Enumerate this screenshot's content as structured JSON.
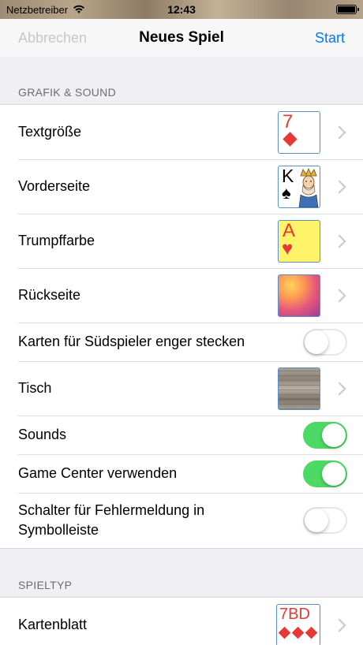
{
  "status_bar": {
    "carrier": "Netzbetreiber",
    "time": "12:43"
  },
  "nav": {
    "cancel_label": "Abbrechen",
    "title": "Neues Spiel",
    "start_label": "Start"
  },
  "sections": {
    "graphics": {
      "header": "GRAFIK & SOUND",
      "rows": {
        "text_size": {
          "label": "Textgröße",
          "card_rank": "7"
        },
        "front": {
          "label": "Vorderseite",
          "card_rank": "K"
        },
        "trump_color": {
          "label": "Trumpffarbe",
          "card_rank": "A"
        },
        "back": {
          "label": "Rückseite"
        },
        "tighter_cards": {
          "label": "Karten für Südspieler enger stecken",
          "toggle_on": false
        },
        "table": {
          "label": "Tisch"
        },
        "sounds": {
          "label": "Sounds",
          "toggle_on": true
        },
        "game_center": {
          "label": "Game Center verwenden",
          "toggle_on": true
        },
        "error_switch": {
          "label": "Schalter für Fehlermeldung in Symbolleiste",
          "toggle_on": false
        }
      }
    },
    "game_type": {
      "header": "SPIELTYP",
      "rows": {
        "deck": {
          "label": "Kartenblatt",
          "card_ranks": "7BD"
        }
      }
    }
  },
  "colors": {
    "accent": "#007aff",
    "toggle_on": "#4cd964",
    "card_red": "#e53935",
    "trump_card_bg": "#fff36a"
  }
}
